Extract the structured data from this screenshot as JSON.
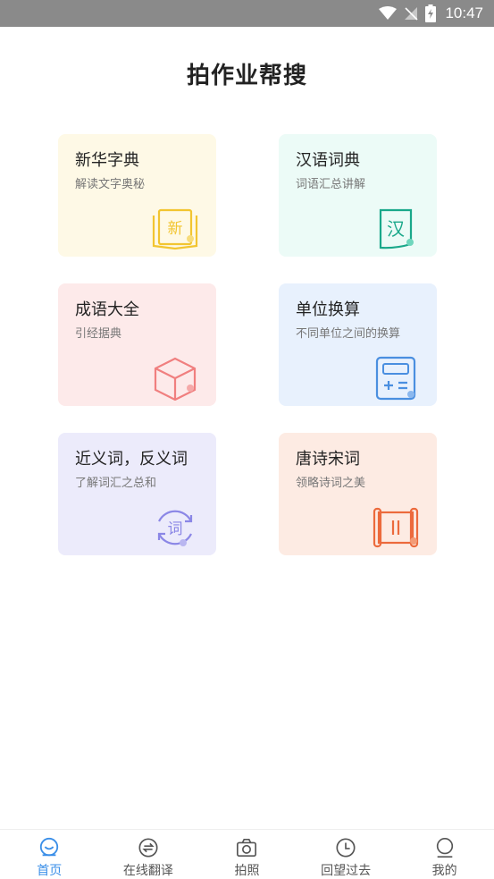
{
  "status_bar": {
    "time": "10:47"
  },
  "header": {
    "title": "拍作业帮搜"
  },
  "cards": [
    {
      "title": "新华字典",
      "subtitle": "解读文字奥秘",
      "icon_name": "book-icon",
      "icon_glyph": "新",
      "color": "#f2c530"
    },
    {
      "title": "汉语词典",
      "subtitle": "词语汇总讲解",
      "icon_name": "dictionary-icon",
      "icon_glyph": "汉",
      "color": "#1aa88a"
    },
    {
      "title": "成语大全",
      "subtitle": "引经据典",
      "icon_name": "cube-icon",
      "color": "#f07f7f"
    },
    {
      "title": "单位换算",
      "subtitle": "不同单位之间的换算",
      "icon_name": "calculator-icon",
      "color": "#4a8fe0"
    },
    {
      "title": "近义词，反义词",
      "subtitle": "了解词汇之总和",
      "icon_name": "synonym-icon",
      "icon_glyph": "词",
      "color": "#8b87e6"
    },
    {
      "title": "唐诗宋词",
      "subtitle": "领略诗词之美",
      "icon_name": "scroll-icon",
      "color": "#ec6a3c"
    }
  ],
  "tabs": [
    {
      "label": "首页",
      "icon_name": "home-face-icon",
      "active": true
    },
    {
      "label": "在线翻译",
      "icon_name": "translate-icon",
      "active": false
    },
    {
      "label": "拍照",
      "icon_name": "camera-icon",
      "active": false
    },
    {
      "label": "回望过去",
      "icon_name": "clock-icon",
      "active": false
    },
    {
      "label": "我的",
      "icon_name": "profile-icon",
      "active": false
    }
  ],
  "colors": {
    "accent": "#3b8fe8",
    "tab_inactive": "#555555",
    "status_bar": "#8a8a8a"
  }
}
